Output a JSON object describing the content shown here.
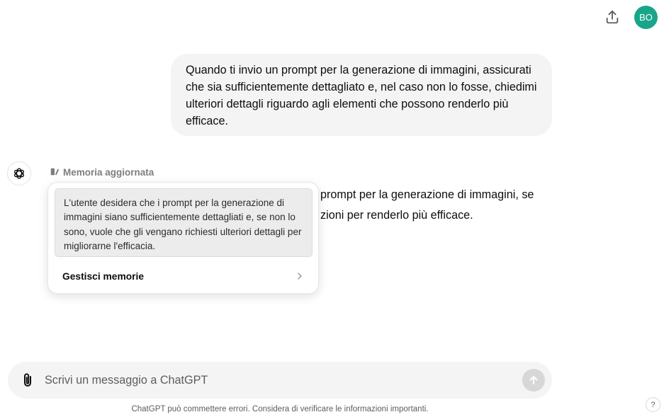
{
  "header": {
    "share_icon": "share-upload-icon",
    "avatar_initials": "BO",
    "avatar_color": "#19a58a"
  },
  "user_message": {
    "text": "Quando ti invio un prompt per la generazione di immagini, assicurati che sia sufficientemente dettagliato e, nel caso non lo fosse, chiedimi ulteriori dettagli riguardo agli elementi che possono renderlo più efficace."
  },
  "assistant": {
    "logo_icon": "chatgpt-logo-icon",
    "memory_header_icon": "memory-edit-icon",
    "memory_header_label": "Memoria aggiornata",
    "visible_line_1": "prompt per la generazione di immagini, se",
    "visible_line_2": "zioni per renderlo più efficace."
  },
  "memory_popup": {
    "memory_text": "L'utente desidera che i prompt per la generazione di immagini siano sufficientemente dettagliati e, se non lo sono, vuole che gli vengano richiesti ulteriori dettagli per migliorarne l'efficacia.",
    "manage_label": "Gestisci memorie",
    "manage_icon": "chevron-right-icon"
  },
  "composer": {
    "placeholder": "Scrivi un messaggio a ChatGPT",
    "value": "",
    "attach_icon": "paperclip-icon",
    "send_icon": "arrow-up-icon"
  },
  "footer": {
    "disclaimer": "ChatGPT può commettere errori. Considera di verificare le informazioni importanti.",
    "help_label": "?"
  }
}
